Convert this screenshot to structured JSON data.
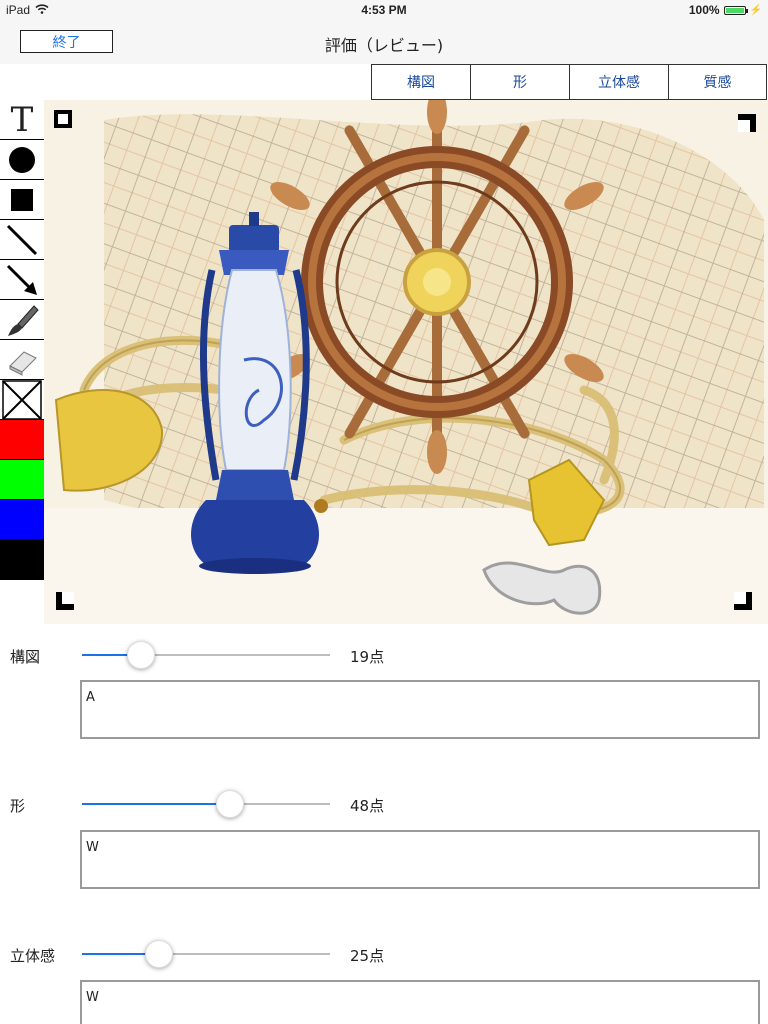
{
  "status_bar": {
    "device": "iPad",
    "time": "4:53 PM",
    "battery": "100%",
    "battery_level": 1.0
  },
  "nav": {
    "done_label": "終了",
    "title": "評価（レビュー)"
  },
  "tabs": [
    "構図",
    "形",
    "立体感",
    "質感"
  ],
  "toolbar": {
    "tools": [
      "text-tool-icon",
      "circle-tool-icon",
      "square-tool-icon",
      "line-tool-icon",
      "arrow-tool-icon",
      "brush-tool-icon",
      "eraser-tool-icon",
      "clear-tool-icon"
    ],
    "text_tool_glyph": "T",
    "colors": [
      "#ff0000",
      "#00ff00",
      "#0000ff",
      "#000000",
      "#ffffff"
    ]
  },
  "scores": [
    {
      "label": "構図",
      "value": 19,
      "score_text": "19点",
      "comment": "A"
    },
    {
      "label": "形",
      "value": 48,
      "score_text": "48点",
      "comment": "W"
    },
    {
      "label": "立体感",
      "value": 25,
      "score_text": "25点",
      "comment": "W"
    }
  ],
  "slider_max": 100
}
